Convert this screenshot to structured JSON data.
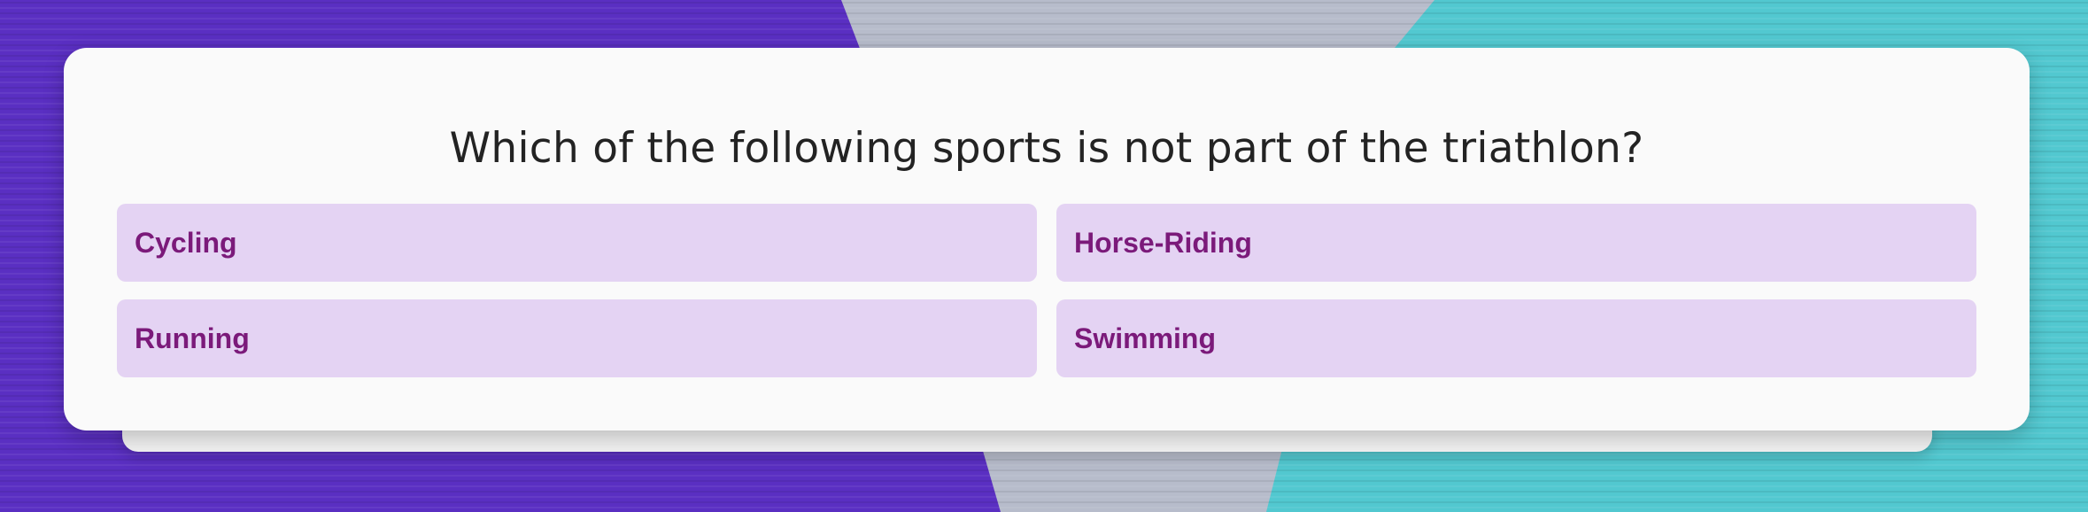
{
  "quiz": {
    "question": "Which of the following sports is not part of the triathlon?",
    "options": [
      {
        "label": "Cycling"
      },
      {
        "label": "Horse-Riding"
      },
      {
        "label": "Running"
      },
      {
        "label": "Swimming"
      }
    ]
  },
  "colors": {
    "background_left": "#5a2fc2",
    "background_middle": "#b7bccb",
    "background_right": "#52c8d0",
    "card": "#fafafa",
    "option_fill": "#e4d3f3",
    "option_text": "#7b1a7a",
    "question_text": "#232323"
  }
}
